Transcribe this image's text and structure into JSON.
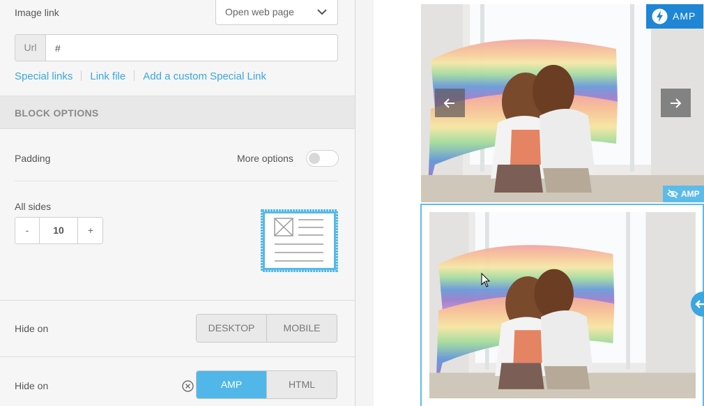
{
  "image_link": {
    "label": "Image link",
    "action_value": "Open web page"
  },
  "url": {
    "prefix": "Url",
    "value": "#"
  },
  "links": {
    "special_links": "Special links",
    "link_file": "Link file",
    "custom_special_link": "Add a custom Special Link"
  },
  "block_options": {
    "title": "BLOCK OPTIONS",
    "padding_label": "Padding",
    "more_options_label": "More options",
    "more_options_on": false,
    "all_sides_label": "All sides",
    "minus": "-",
    "plus": "+",
    "padding_value": "10"
  },
  "hide_on_device": {
    "label": "Hide on",
    "options": [
      "DESKTOP",
      "MOBILE"
    ]
  },
  "hide_on_format": {
    "label": "Hide on",
    "options": [
      "AMP",
      "HTML"
    ],
    "active": "AMP"
  },
  "preview": {
    "amp_badge": "AMP",
    "amp_hidden_badge": "AMP",
    "image_alt": "Two women embracing while holding a rainbow pride flag by a window"
  },
  "colors": {
    "accent": "#50b7e8",
    "link": "#3aa7dc",
    "amp_badge": "#1e86d4"
  },
  "icons": [
    "chevron-down-icon",
    "lightning-bolt-icon",
    "arrow-left-icon",
    "arrow-right-icon",
    "eye-slash-icon",
    "clear-circle-icon",
    "cursor-icon"
  ]
}
